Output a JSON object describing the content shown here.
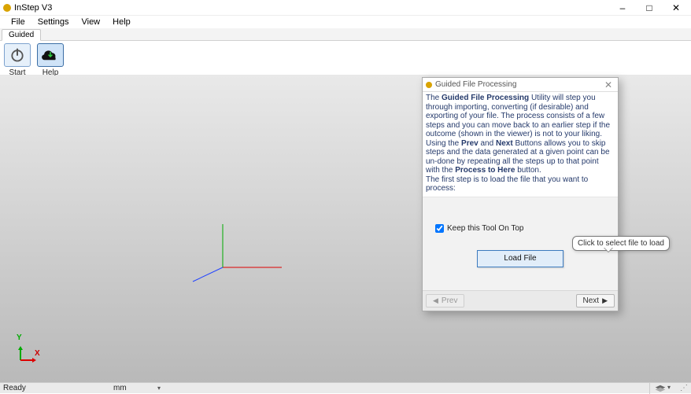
{
  "window": {
    "title": "InStep V3",
    "buttons": {
      "min": "–",
      "max": "□",
      "close": "✕"
    }
  },
  "menu": {
    "items": [
      "File",
      "Settings",
      "View",
      "Help"
    ]
  },
  "tabs": {
    "active": "Guided"
  },
  "toolbar": {
    "start": {
      "label": "Start",
      "icon": "power-icon"
    },
    "help": {
      "label": "Help",
      "icon": "cloud-download-icon"
    }
  },
  "axes": {
    "y": "Y",
    "x": "X"
  },
  "dialog": {
    "title": "Guided File Processing",
    "paragraph": {
      "pre1": "The ",
      "b1": "Guided File Processing",
      "seg1": " Utility will step you through importing, converting (if desirable) and exporting of your file. The process consists of a few steps and you can move back to an earlier step if the outcome (shown in the viewer) is not to your liking. Using the ",
      "b2": "Prev",
      "seg2": " and ",
      "b3": "Next",
      "seg3": " Buttons allows you to skip steps and the data generated at a given point can be un-done by repeating all the steps up to that point with the ",
      "b4": "Process to Here",
      "seg4": " button.",
      "line2": "The first step is to load the file that you want to process:"
    },
    "keep_on_top_label": "Keep this Tool On Top",
    "keep_on_top_checked": true,
    "load_button": "Load File",
    "tooltip": "Click to select file to load",
    "prev": "Prev",
    "next": "Next"
  },
  "status": {
    "ready": "Ready",
    "unit": "mm",
    "coord": "",
    "layers_icon": "layers-icon"
  }
}
